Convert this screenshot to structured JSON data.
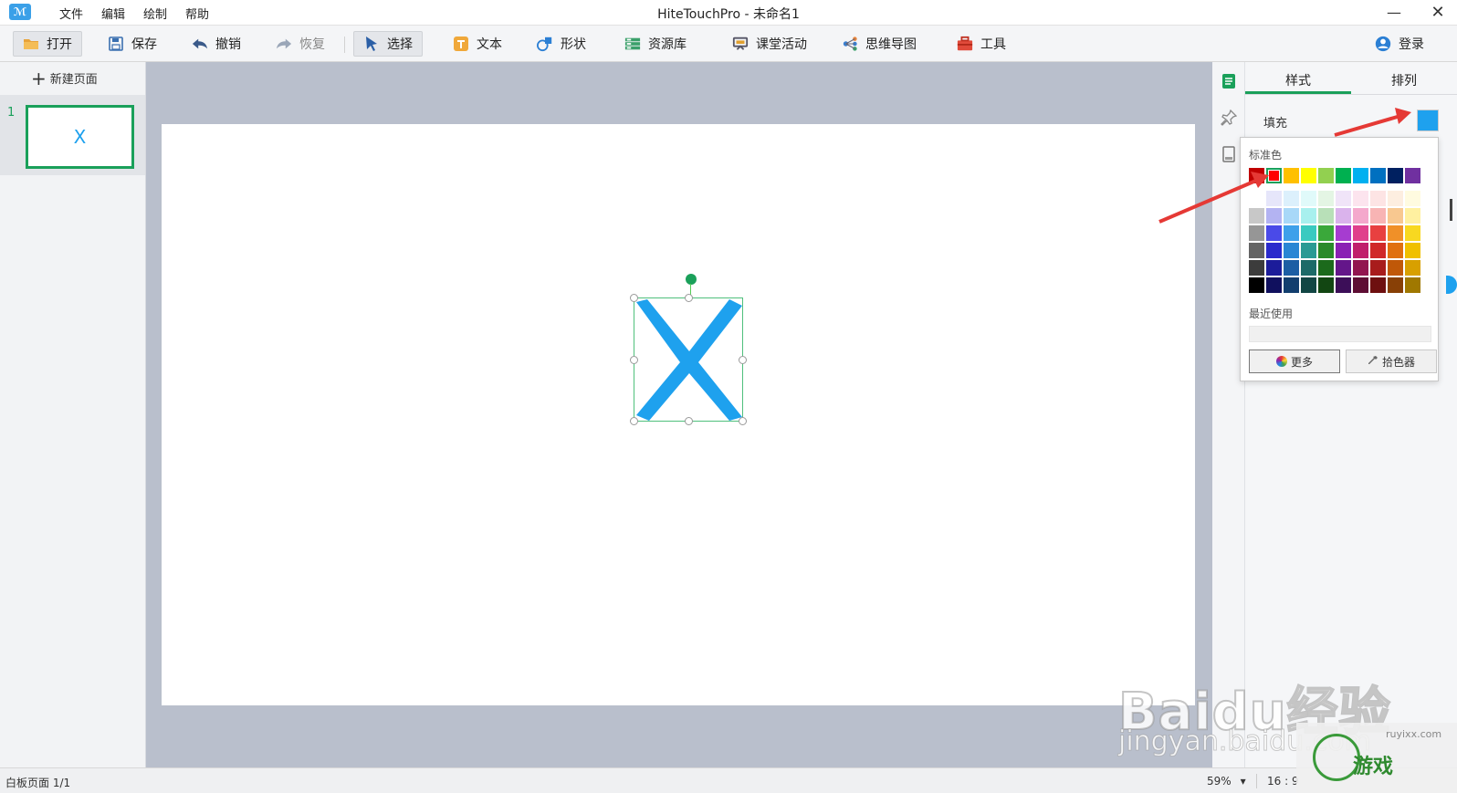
{
  "app": {
    "window_title": "HiteTouchPro - 未命名1",
    "menu": [
      "文件",
      "编辑",
      "绘制",
      "帮助"
    ],
    "minimize_glyph": "—",
    "close_glyph": "✕"
  },
  "toolbar": {
    "open": "打开",
    "save": "保存",
    "undo": "撤销",
    "redo": "恢复",
    "select": "选择",
    "text": "文本",
    "shape": "形状",
    "library": "资源库",
    "activity": "课堂活动",
    "mindmap": "思维导图",
    "tools": "工具",
    "login": "登录"
  },
  "pages": {
    "new_page": "新建页面",
    "items": [
      {
        "number": "1",
        "thumb_glyph": "X"
      }
    ]
  },
  "canvas": {
    "shape": "X",
    "shape_color": "#1ea1ee"
  },
  "panel": {
    "tab_style": "样式",
    "tab_arrange": "排列",
    "fill_label": "填充",
    "fill_color": "#1ea1ee"
  },
  "color_popup": {
    "standard_label": "标准色",
    "standard": [
      "#c00000",
      "#ff0000",
      "#ffc000",
      "#ffff00",
      "#92d050",
      "#00b050",
      "#00b0f0",
      "#0070c0",
      "#002060",
      "#7030a0"
    ],
    "selected_index": 1,
    "gradient_rows": [
      [
        "#ffffff",
        "#e6e6fa",
        "#dcf0fc",
        "#e0fafa",
        "#e4f5e4",
        "#f0e4f8",
        "#fce4ee",
        "#fde4e4",
        "#fdeee0",
        "#fffbe0"
      ],
      [
        "#c8c8c8",
        "#b3b3f2",
        "#a8d8f8",
        "#a8f0ee",
        "#b8e0b8",
        "#dab3ec",
        "#f4a8cc",
        "#f8b4b4",
        "#f8c890",
        "#fff0a0"
      ],
      [
        "#969696",
        "#4a4ae8",
        "#3ea0ea",
        "#3acac0",
        "#3aa83a",
        "#a63cd0",
        "#e0408c",
        "#e84040",
        "#f09028",
        "#f8d820"
      ],
      [
        "#646464",
        "#2a2acc",
        "#2a86d4",
        "#2a9a94",
        "#2a8a2a",
        "#8a20b4",
        "#c0206c",
        "#d02828",
        "#e07010",
        "#f0c000"
      ],
      [
        "#3c3c3c",
        "#1c1c9a",
        "#1c5ea4",
        "#1c6a68",
        "#1c6a1c",
        "#64168a",
        "#921650",
        "#a81c1c",
        "#c05808",
        "#d8a000"
      ],
      [
        "#000000",
        "#10105e",
        "#123e6e",
        "#124644",
        "#124612",
        "#3c0e58",
        "#5e0e34",
        "#6e1010",
        "#884006",
        "#a07800"
      ]
    ],
    "recent_label": "最近使用",
    "more": "更多",
    "picker": "拾色器"
  },
  "status": {
    "page": "白板页面 1/1",
    "zoom": "59%",
    "zoom_caret": "▾",
    "ratio": "16 : 9"
  },
  "watermark": {
    "baidu": "Baidu经验",
    "jingyan": "jingyan.baidu.com",
    "game_text": "游戏",
    "game_url": "ruyixx.com"
  }
}
